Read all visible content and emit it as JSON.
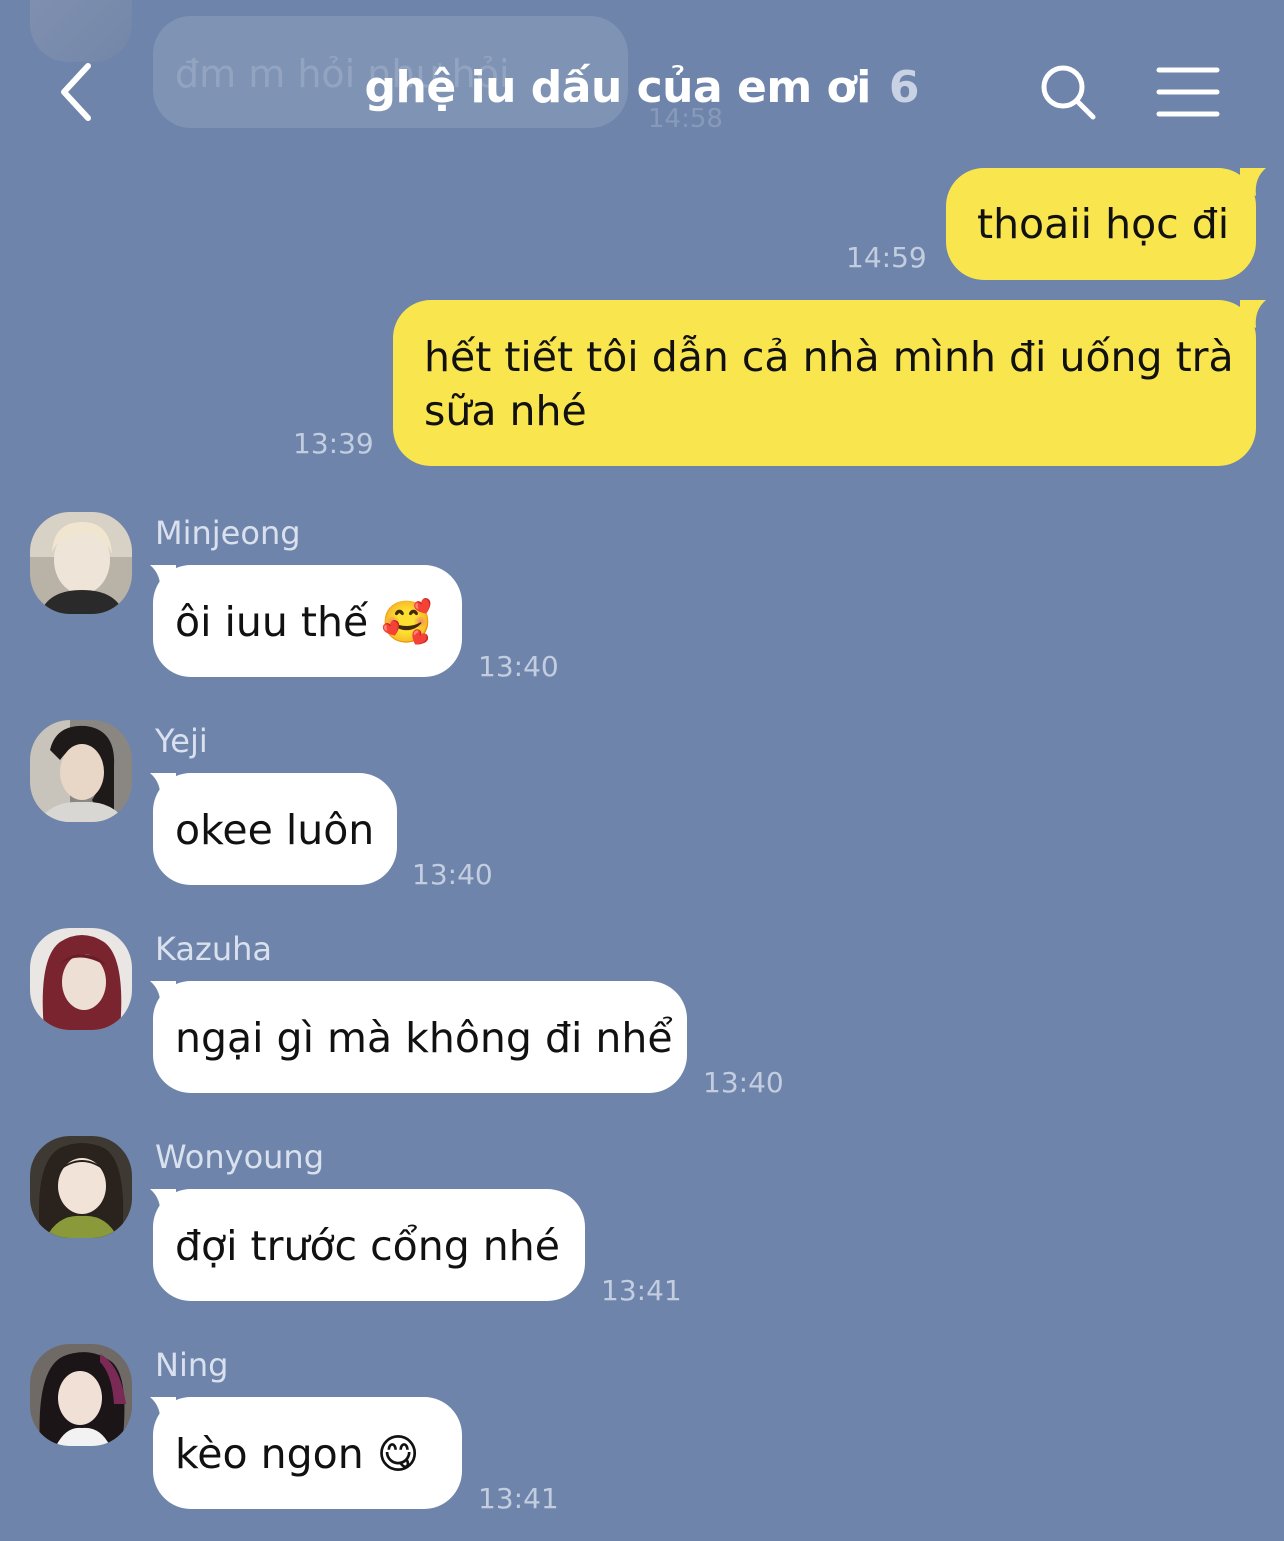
{
  "header": {
    "back_icon": "chevron-left-icon",
    "title": "ghệ iu dấu của em ơi",
    "member_count": "6",
    "search_icon": "search-icon",
    "menu_icon": "hamburger-menu-icon"
  },
  "ghost_message": {
    "text": "đm m hỏi như hỏi",
    "time": "14:58"
  },
  "messages": [
    {
      "type": "mine",
      "text": "thoaii học đi",
      "time": "14:59"
    },
    {
      "type": "mine",
      "text_line1": "hết tiết tôi dẫn cả nhà mình đi uống trà",
      "text_line2": "sữa nhé",
      "time": "13:39"
    },
    {
      "type": "other",
      "sender": "Minjeong",
      "text": "ôi iuu thế 🥰",
      "time": "13:40"
    },
    {
      "type": "other",
      "sender": "Yeji",
      "text": "okee luôn",
      "time": "13:40"
    },
    {
      "type": "other",
      "sender": "Kazuha",
      "text": "ngại gì mà không đi nhể",
      "time": "13:40"
    },
    {
      "type": "other",
      "sender": "Wonyoung",
      "text": "đợi trước cổng nhé",
      "time": "13:41"
    },
    {
      "type": "other",
      "sender": "Ning",
      "text": "kèo ngon 😋",
      "time": "13:41"
    }
  ],
  "colors": {
    "background": "#6e84aa",
    "my_bubble": "#f9e54e",
    "other_bubble": "#ffffff",
    "timestamp": "#c3cde0"
  }
}
